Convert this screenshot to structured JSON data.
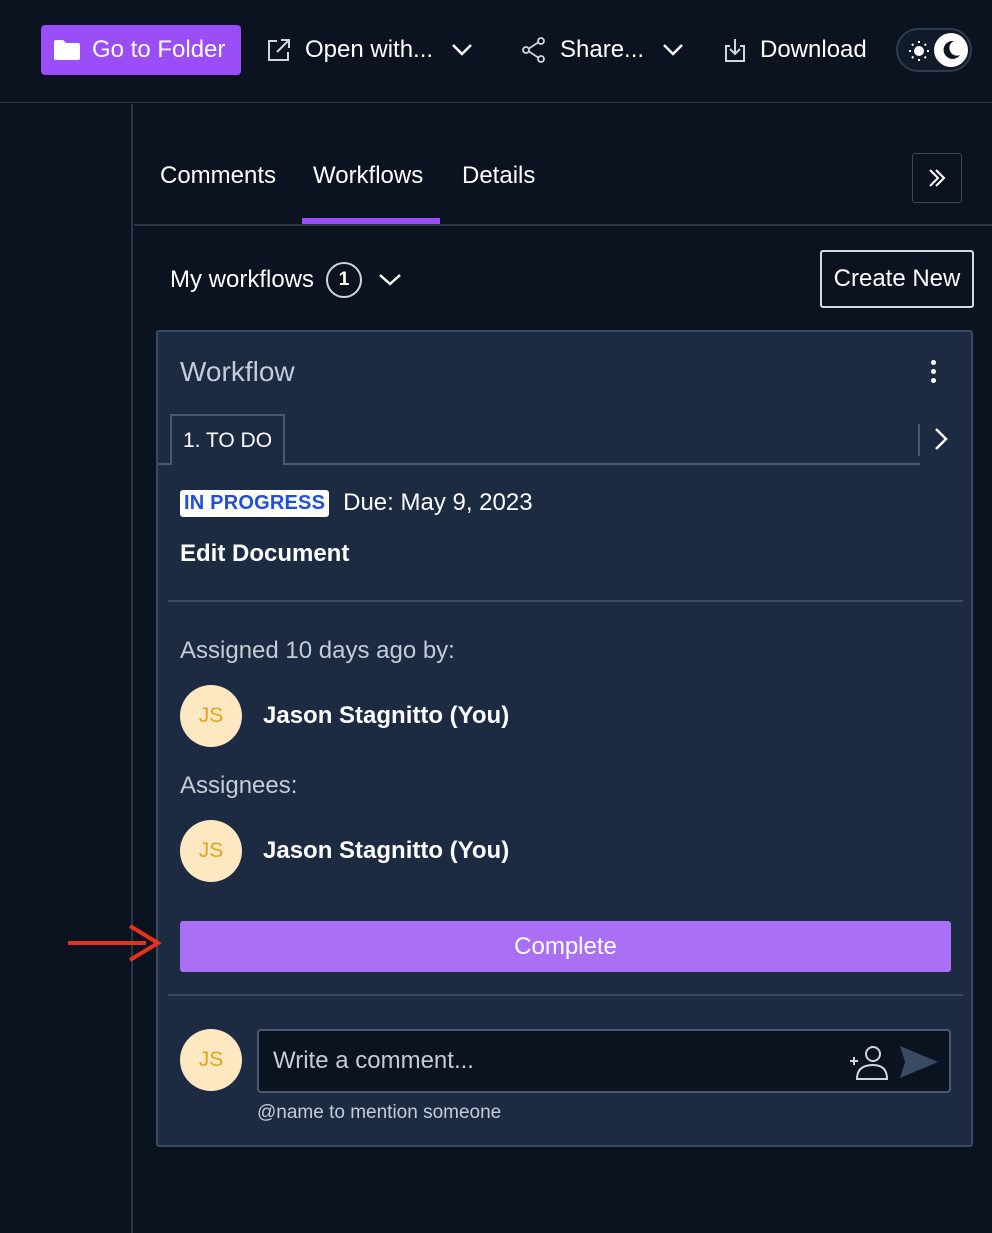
{
  "toolbar": {
    "go_to_folder": "Go to Folder",
    "open_with": "Open with...",
    "share": "Share...",
    "download": "Download",
    "icons": {
      "folder": "folder-icon",
      "open_with": "external-link-icon",
      "share": "share-icon",
      "download": "download-icon",
      "theme": "sun-moon-toggle-icon"
    }
  },
  "tabs": [
    {
      "label": "Comments",
      "active": false
    },
    {
      "label": "Workflows",
      "active": true
    },
    {
      "label": "Details",
      "active": false
    }
  ],
  "workflows": {
    "filter_label": "My workflows",
    "count": "1",
    "create_new": "Create New"
  },
  "card": {
    "title": "Workflow",
    "stage": "1. TO DO",
    "status": "IN PROGRESS",
    "due": "Due: May 9, 2023",
    "task": "Edit Document",
    "assigned_label": "Assigned 10 days ago by:",
    "assigner": {
      "initials": "JS",
      "name": "Jason Stagnitto (You)"
    },
    "assignees_label": "Assignees:",
    "assignee": {
      "initials": "JS",
      "name": "Jason Stagnitto (You)"
    },
    "complete_label": "Complete",
    "comment": {
      "avatar_initials": "JS",
      "placeholder": "Write a comment...",
      "value": "",
      "hint": "@name to mention someone"
    }
  },
  "colors": {
    "background": "#0b1220",
    "card": "#1c2a42",
    "accent": "#9b4ef7",
    "complete_button": "#a970f5",
    "status_text": "#1f4fd6",
    "avatar_bg": "#fde8c2",
    "avatar_text": "#e2a51c",
    "annotation_arrow": "#e8321e"
  }
}
